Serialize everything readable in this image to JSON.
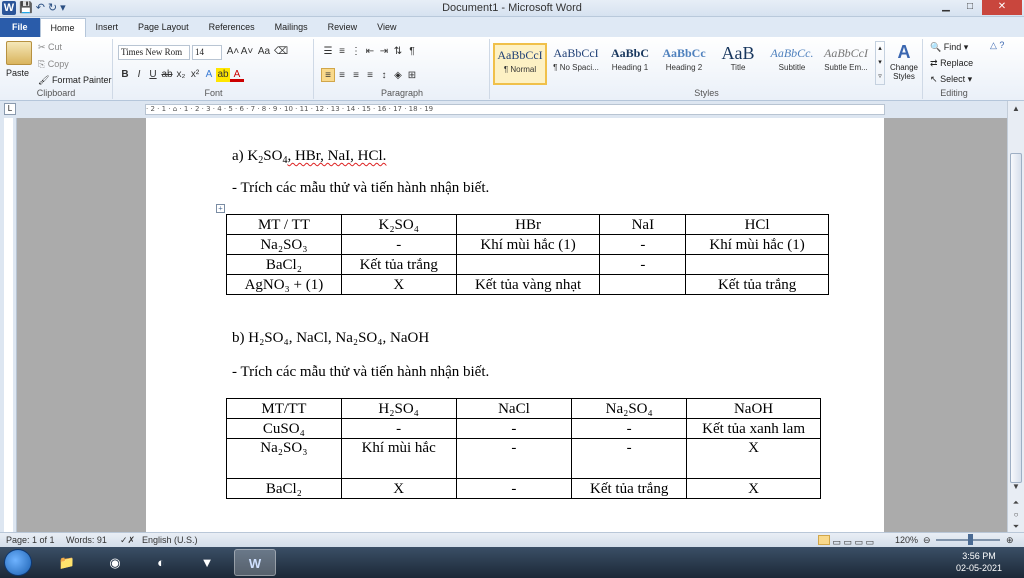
{
  "window": {
    "title": "Document1 - Microsoft Word",
    "controls": [
      "minimize",
      "maximize",
      "close"
    ]
  },
  "quick_access": {
    "logo": "W",
    "save": "💾",
    "undo": "↶",
    "redo": "↻",
    "customize": "▾"
  },
  "tabs": [
    "File",
    "Home",
    "Insert",
    "Page Layout",
    "References",
    "Mailings",
    "Review",
    "View"
  ],
  "active_tab": "Home",
  "ribbon": {
    "clipboard": {
      "paste": "Paste",
      "cut": "Cut",
      "copy": "Copy",
      "format_painter": "Format Painter",
      "label": "Clipboard"
    },
    "font": {
      "font_name": "Times New Rom",
      "font_size": "14",
      "label": "Font"
    },
    "paragraph": {
      "label": "Paragraph"
    },
    "styles": {
      "items": [
        {
          "sample": "AaBbCcI",
          "name": "¶ Normal"
        },
        {
          "sample": "AaBbCcI",
          "name": "¶ No Spaci..."
        },
        {
          "sample": "AaBbC",
          "name": "Heading 1"
        },
        {
          "sample": "AaBbCc",
          "name": "Heading 2"
        },
        {
          "sample": "AaB",
          "name": "Title"
        },
        {
          "sample": "AaBbCc.",
          "name": "Subtitle"
        },
        {
          "sample": "AaBbCcI",
          "name": "Subtle Em..."
        }
      ],
      "change_styles": "Change Styles",
      "label": "Styles"
    },
    "editing": {
      "find": "Find",
      "replace": "Replace",
      "select": "Select",
      "label": "Editing"
    }
  },
  "ruler": {
    "marks": "· 2 · 1 · ⌂ · 1 · 2 · 3 · 4 · 5 · 6 · 7 · 8 · 9 · 10 · 11 · 12 · 13 · 14 · 15 · 16 · 17 · 18 · 19"
  },
  "document": {
    "section_a": {
      "heading_prefix": "a) K",
      "heading_sub": "2",
      "heading_mid": "SO",
      "heading_sub2": "4",
      "heading_rest": ", HBr, NaI, HCl.",
      "intro": "- Trích các mẫu thử và tiến hành nhận biết.",
      "table": [
        [
          "MT / TT",
          "K₂SO₄",
          "HBr",
          "NaI",
          "HCl"
        ],
        [
          "Na₂SO₃",
          "-",
          "Khí mùi hắc (1)",
          "-",
          "Khí mùi hắc (1)"
        ],
        [
          "BaCl₂",
          "Kết tủa trắng",
          "",
          "-",
          ""
        ],
        [
          "AgNO₃ + (1)",
          "X",
          "Kết tủa vàng nhạt",
          "",
          "Kết tủa trắng"
        ]
      ]
    },
    "section_b": {
      "heading": "b) H₂SO₄, NaCl, Na₂SO₄, NaOH",
      "intro": "- Trích các mẫu thử và tiến hành nhận biết.",
      "table": [
        [
          "MT/TT",
          "H₂SO₄",
          "NaCl",
          "Na₂SO₄",
          "NaOH"
        ],
        [
          "CuSO₄",
          "-",
          "-",
          "-",
          "Kết tủa xanh lam"
        ],
        [
          "Na₂SO₃",
          "Khí mùi hắc",
          "-",
          "-",
          "X"
        ],
        [
          "BaCl₂",
          "X",
          "-",
          "Kết tủa trắng",
          "X"
        ]
      ]
    }
  },
  "status": {
    "page": "Page: 1 of 1",
    "words": "Words: 91",
    "language": "English (U.S.)",
    "zoom": "120%"
  },
  "taskbar": {
    "time": "3:56 PM",
    "date": "02-05-2021"
  }
}
